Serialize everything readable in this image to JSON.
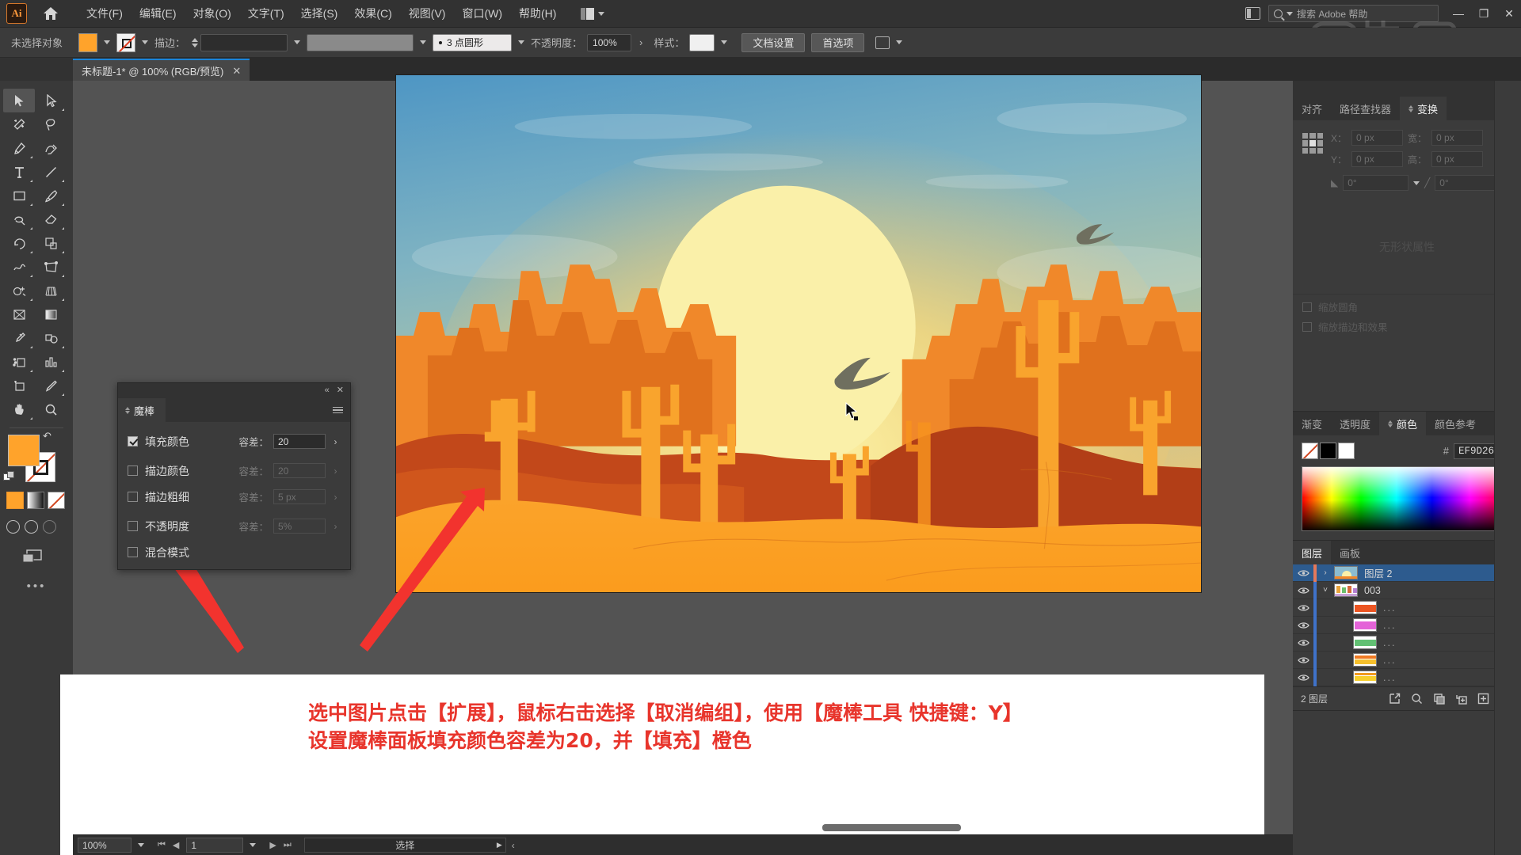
{
  "app": {
    "logo": "Ai",
    "home_icon": "home-icon"
  },
  "menubar": {
    "items": [
      {
        "label": "文件(F)",
        "name": "menu-file"
      },
      {
        "label": "编辑(E)",
        "name": "menu-edit"
      },
      {
        "label": "对象(O)",
        "name": "menu-object"
      },
      {
        "label": "文字(T)",
        "name": "menu-type"
      },
      {
        "label": "选择(S)",
        "name": "menu-select"
      },
      {
        "label": "效果(C)",
        "name": "menu-effect"
      },
      {
        "label": "视图(V)",
        "name": "menu-view"
      },
      {
        "label": "窗口(W)",
        "name": "menu-window"
      },
      {
        "label": "帮助(H)",
        "name": "menu-help"
      }
    ],
    "search_placeholder": "搜索 Adobe 帮助",
    "minimize": "—",
    "restore": "❐",
    "close": "✕"
  },
  "controlbar": {
    "selection_status": "未选择对象",
    "fill_color": "#FFA32B",
    "stroke_label": "描边：",
    "stroke_weight": "",
    "brush_def": "",
    "profile_label": "3 点圆形",
    "opacity_label": "不透明度：",
    "opacity_value": "100%",
    "style_label": "样式：",
    "doc_setup": "文档设置",
    "preferences": "首选项"
  },
  "tabbar": {
    "doc_title": "未标题-1* @ 100% (RGB/预览)",
    "close": "✕"
  },
  "toolbar": {
    "tools": [
      {
        "name": "selection-tool",
        "active": true
      },
      {
        "name": "direct-selection-tool",
        "active": false
      },
      {
        "name": "magic-wand-tool",
        "active": false
      },
      {
        "name": "lasso-tool",
        "active": false
      },
      {
        "name": "pen-tool",
        "active": false
      },
      {
        "name": "curvature-tool",
        "active": false
      },
      {
        "name": "type-tool",
        "active": false
      },
      {
        "name": "line-segment-tool",
        "active": false
      },
      {
        "name": "rectangle-tool",
        "active": false
      },
      {
        "name": "paintbrush-tool",
        "active": false
      },
      {
        "name": "shaper-tool",
        "active": false
      },
      {
        "name": "eraser-tool",
        "active": false
      },
      {
        "name": "rotate-tool",
        "active": false
      },
      {
        "name": "scale-tool",
        "active": false
      },
      {
        "name": "width-tool",
        "active": false
      },
      {
        "name": "free-transform-tool",
        "active": false
      },
      {
        "name": "shape-builder-tool",
        "active": false
      },
      {
        "name": "perspective-grid-tool",
        "active": false
      },
      {
        "name": "mesh-tool",
        "active": false
      },
      {
        "name": "gradient-tool",
        "active": false
      },
      {
        "name": "eyedropper-tool",
        "active": false
      },
      {
        "name": "blend-tool",
        "active": false
      },
      {
        "name": "symbol-sprayer-tool",
        "active": false
      },
      {
        "name": "column-graph-tool",
        "active": false
      },
      {
        "name": "artboard-tool",
        "active": false
      },
      {
        "name": "slice-tool",
        "active": false
      },
      {
        "name": "hand-tool",
        "active": false
      },
      {
        "name": "zoom-tool",
        "active": false
      }
    ],
    "fill_color": "#FFA32B",
    "stroke_color": "none",
    "modes": [
      "color-mode",
      "gradient-mode",
      "none-mode"
    ],
    "more_dots": "•••"
  },
  "magic_wand_panel": {
    "title": "魔棒",
    "collapse": "«",
    "close": "✕",
    "rows": [
      {
        "label": "填充颜色",
        "checked": true,
        "tol_label": "容差：",
        "tol_value": "20",
        "enabled": true,
        "name": "fill-color-row"
      },
      {
        "label": "描边颜色",
        "checked": false,
        "tol_label": "容差：",
        "tol_value": "20",
        "enabled": false,
        "name": "stroke-color-row"
      },
      {
        "label": "描边粗细",
        "checked": false,
        "tol_label": "容差：",
        "tol_value": "5 px",
        "enabled": false,
        "name": "stroke-weight-row"
      },
      {
        "label": "不透明度",
        "checked": false,
        "tol_label": "容差：",
        "tol_value": "5%",
        "enabled": false,
        "name": "opacity-row"
      },
      {
        "label": "混合模式",
        "checked": false,
        "tol_label": "",
        "tol_value": "",
        "enabled": false,
        "name": "blend-mode-row"
      }
    ]
  },
  "transform_panel": {
    "collapse": "«",
    "close": "✕",
    "tabs": [
      {
        "label": "对齐",
        "active": false,
        "name": "tab-align"
      },
      {
        "label": "路径查找器",
        "active": false,
        "name": "tab-pathfinder"
      },
      {
        "label": "变换",
        "active": true,
        "name": "tab-transform"
      }
    ],
    "x_label": "X：",
    "x_value": "0 px",
    "y_label": "Y：",
    "y_value": "0 px",
    "w_label": "宽：",
    "w_value": "0 px",
    "h_label": "高：",
    "h_value": "0 px",
    "angle_value": "0°",
    "shear_value": "0°",
    "empty_text": "无形状属性",
    "check_scale_corners": "缩放圆角",
    "check_scale_strokes": "缩放描边和效果"
  },
  "color_panel": {
    "tabs": [
      {
        "label": "渐变",
        "active": false,
        "name": "tab-gradient"
      },
      {
        "label": "透明度",
        "active": false,
        "name": "tab-transparency"
      },
      {
        "label": "颜色",
        "active": true,
        "name": "tab-color"
      },
      {
        "label": "颜色参考",
        "active": false,
        "name": "tab-color-guide"
      }
    ],
    "hash": "#",
    "hex_value": "EF9D26"
  },
  "layers_panel": {
    "tabs": [
      {
        "label": "图层",
        "active": true,
        "name": "tab-layers"
      },
      {
        "label": "画板",
        "active": false,
        "name": "tab-artboards"
      }
    ],
    "rows": [
      {
        "name": "图层 2",
        "selected": true,
        "indent": 0,
        "twisty": "›",
        "bar": "#e4795b",
        "thumb": "sunset"
      },
      {
        "name": "003",
        "selected": false,
        "indent": 0,
        "twisty": "˅",
        "bar": "#3f72c9",
        "thumb": "multi"
      },
      {
        "name": "...",
        "selected": false,
        "indent": 1,
        "twisty": "",
        "bar": "#3f72c9",
        "thumb": "red"
      },
      {
        "name": "...",
        "selected": false,
        "indent": 1,
        "twisty": "",
        "bar": "#3f72c9",
        "thumb": "magenta"
      },
      {
        "name": "...",
        "selected": false,
        "indent": 1,
        "twisty": "",
        "bar": "#3f72c9",
        "thumb": "green"
      },
      {
        "name": "...",
        "selected": false,
        "indent": 1,
        "twisty": "",
        "bar": "#3f72c9",
        "thumb": "orange"
      },
      {
        "name": "...",
        "selected": false,
        "indent": 1,
        "twisty": "",
        "bar": "#3f72c9",
        "thumb": "yellow"
      }
    ],
    "count_label": "2 图层",
    "footer_icons": [
      "locate-object-icon",
      "search-icon",
      "make-mask-icon",
      "new-sublayer-icon",
      "new-layer-icon",
      "delete-layer-icon"
    ]
  },
  "statusbar": {
    "zoom": "100%",
    "page": "1",
    "status_text": "选择",
    "more": "‹"
  },
  "annotation": {
    "line1": "选中图片点击【扩展】，鼠标右击选择【取消编组】，使用【魔棒工具 快捷键：Y】",
    "line2": "设置魔棒面板填充颜色容差为20，并【填充】橙色"
  },
  "artwork": {
    "title": "desert-sunset-illustration",
    "colors": {
      "sky_top": "#5d9fc6",
      "sky_mid": "#8dbcc2",
      "sun_glow": "#f4d98a",
      "sun": "#f8f0a8",
      "mesa_light": "#f59a2e",
      "mesa_dark": "#e8731f",
      "dune_dark": "#c2481a",
      "sand": "#fa9b22",
      "cactus": "#f9a42d",
      "bird": "#6d6d5e"
    }
  }
}
